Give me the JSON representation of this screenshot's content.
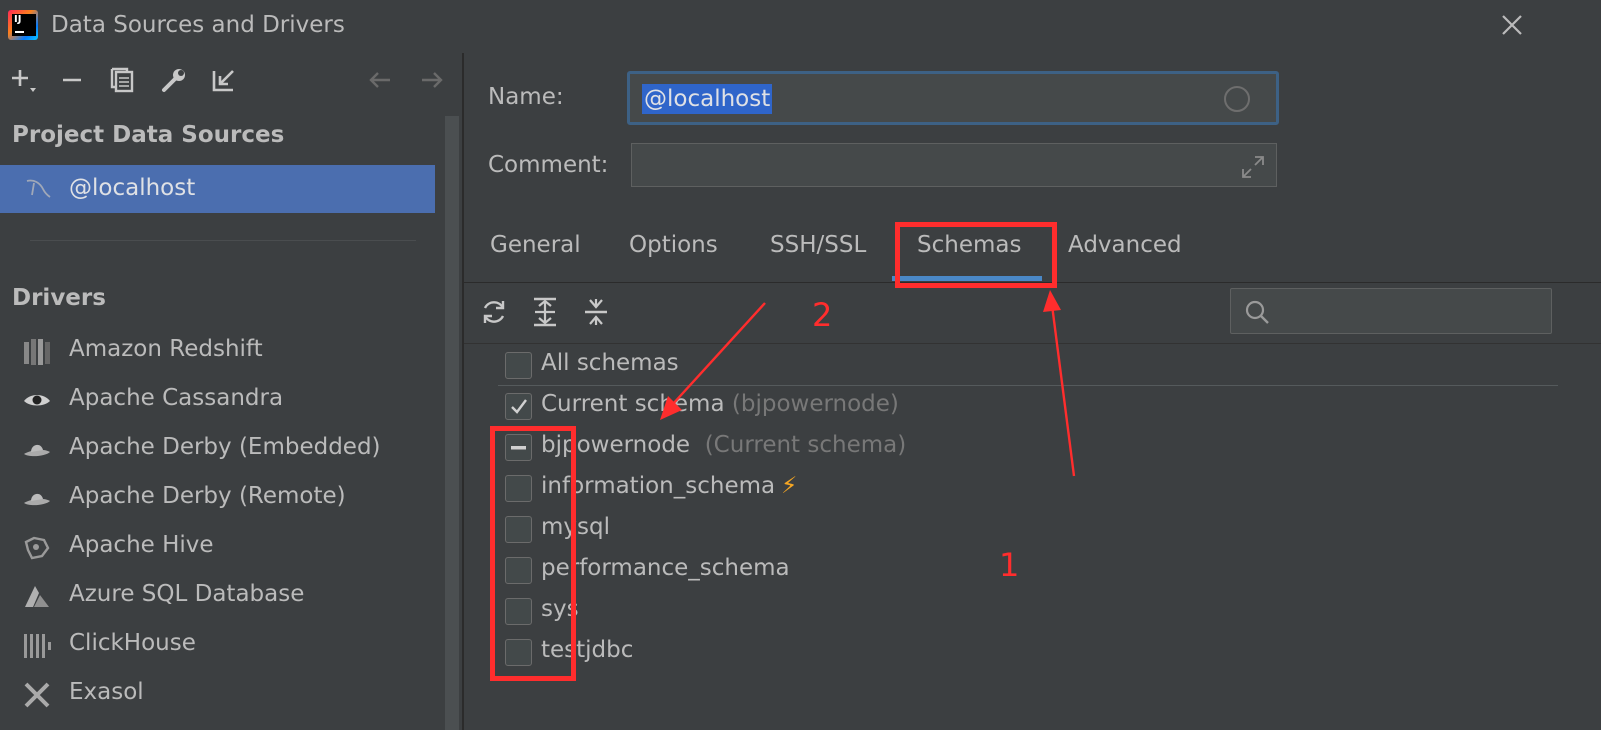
{
  "window": {
    "title": "Data Sources and Drivers"
  },
  "left_toolbar": {
    "icons": [
      "add-icon",
      "remove-icon",
      "copy-icon",
      "wrench-icon",
      "import-icon",
      "back-arrow-icon",
      "forward-arrow-icon"
    ]
  },
  "project_sources": {
    "heading": "Project Data Sources",
    "items": [
      {
        "label": "@localhost",
        "icon": "mysql-dolphin-icon",
        "selected": true
      }
    ]
  },
  "drivers": {
    "heading": "Drivers",
    "items": [
      {
        "label": "Amazon Redshift",
        "icon": "redshift-icon"
      },
      {
        "label": "Apache Cassandra",
        "icon": "cassandra-eye-icon"
      },
      {
        "label": "Apache Derby (Embedded)",
        "icon": "derby-hat-icon"
      },
      {
        "label": "Apache Derby (Remote)",
        "icon": "derby-hat-icon"
      },
      {
        "label": "Apache Hive",
        "icon": "hive-icon"
      },
      {
        "label": "Azure SQL Database",
        "icon": "azure-icon"
      },
      {
        "label": "ClickHouse",
        "icon": "clickhouse-icon"
      },
      {
        "label": "Exasol",
        "icon": "exasol-icon"
      }
    ]
  },
  "form": {
    "name_label": "Name:",
    "name_value": "@localhost",
    "comment_label": "Comment:",
    "comment_value": ""
  },
  "tabs": [
    {
      "label": "General",
      "active": false
    },
    {
      "label": "Options",
      "active": false
    },
    {
      "label": "SSH/SSL",
      "active": false
    },
    {
      "label": "Schemas",
      "active": true
    },
    {
      "label": "Advanced",
      "active": false
    }
  ],
  "schemas": {
    "toolbar_icons": [
      "refresh-icon",
      "expand-all-icon",
      "collapse-all-icon"
    ],
    "search_placeholder": "",
    "all_schemas": {
      "label": "All schemas",
      "state": "unchecked"
    },
    "current_schema": {
      "label": "Current schema",
      "hint": "(bjpowernode)",
      "state": "checked"
    },
    "items": [
      {
        "name": "bjpowernode",
        "hint": "(Current schema)",
        "state": "mixed"
      },
      {
        "name": "information_schema",
        "hint": "",
        "state": "unchecked",
        "badge": "⚡"
      },
      {
        "name": "mysql",
        "hint": "",
        "state": "unchecked"
      },
      {
        "name": "performance_schema",
        "hint": "",
        "state": "unchecked"
      },
      {
        "name": "sys",
        "hint": "",
        "state": "unchecked"
      },
      {
        "name": "testjdbc",
        "hint": "",
        "state": "unchecked"
      }
    ]
  },
  "annotations": {
    "label_1": "1",
    "label_2": "2",
    "color": "#ff2d2d"
  },
  "colors": {
    "accent": "#4b6eaf",
    "tab_underline": "#4a88c7",
    "selection": "#2f65ca",
    "bolt": "#f5a623"
  }
}
